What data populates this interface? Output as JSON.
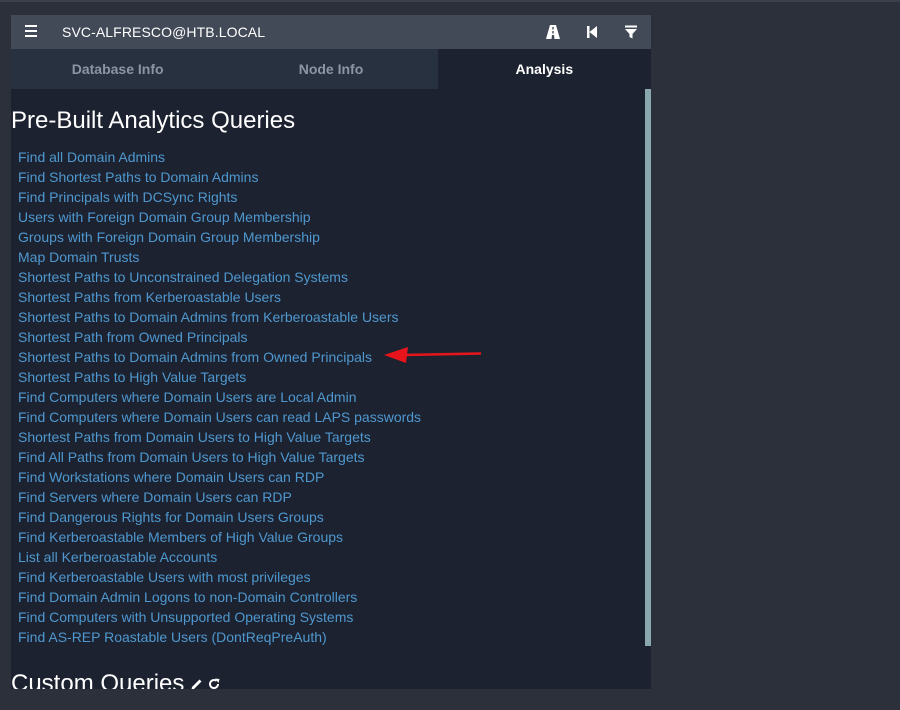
{
  "header": {
    "title": "SVC-ALFRESCO@HTB.LOCAL",
    "icons": [
      "menu-icon",
      "pathfinding-road-icon",
      "step-back-icon",
      "filter-icon"
    ]
  },
  "tabs": [
    {
      "label": "Database Info",
      "active": false
    },
    {
      "label": "Node Info",
      "active": false
    },
    {
      "label": "Analysis",
      "active": true
    }
  ],
  "analysis": {
    "prebuilt_heading": "Pre-Built Analytics Queries",
    "queries": [
      "Find all Domain Admins",
      "Find Shortest Paths to Domain Admins",
      "Find Principals with DCSync Rights",
      "Users with Foreign Domain Group Membership",
      "Groups with Foreign Domain Group Membership",
      "Map Domain Trusts",
      "Shortest Paths to Unconstrained Delegation Systems",
      "Shortest Paths from Kerberoastable Users",
      "Shortest Paths to Domain Admins from Kerberoastable Users",
      "Shortest Path from Owned Principals",
      "Shortest Paths to Domain Admins from Owned Principals",
      "Shortest Paths to High Value Targets",
      "Find Computers where Domain Users are Local Admin",
      "Find Computers where Domain Users can read LAPS passwords",
      "Shortest Paths from Domain Users to High Value Targets",
      "Find All Paths from Domain Users to High Value Targets",
      "Find Workstations where Domain Users can RDP",
      "Find Servers where Domain Users can RDP",
      "Find Dangerous Rights for Domain Users Groups",
      "Find Kerberoastable Members of High Value Groups",
      "List all Kerberoastable Accounts",
      "Find Kerberoastable Users with most privileges",
      "Find Domain Admin Logons to non-Domain Controllers",
      "Find Computers with Unsupported Operating Systems",
      "Find AS-REP Roastable Users (DontReqPreAuth)"
    ],
    "custom_heading": "Custom Queries"
  },
  "annotation": {
    "color": "#e8141b",
    "points_to": "Shortest Paths to Domain Admins from Owned Principals"
  },
  "colors": {
    "background": "#2b303b",
    "panel": "#1c2230",
    "header": "#424a57",
    "link": "#4f98cf",
    "scrollbar": "#8aa9ae"
  }
}
